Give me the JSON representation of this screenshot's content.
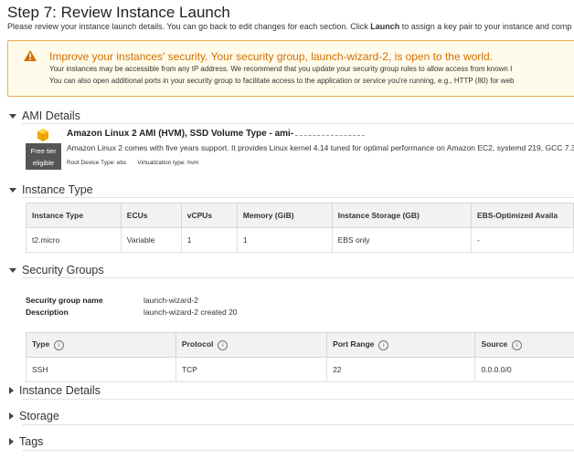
{
  "page": {
    "title": "Step 7: Review Instance Launch",
    "subtitle_pre": "Please review your instance launch details. You can go back to edit changes for each section. Click ",
    "subtitle_bold": "Launch",
    "subtitle_post": " to assign a key pair to your instance and comp"
  },
  "warning": {
    "title": "Improve your instances' security. Your security group, launch-wizard-2, is open to the world.",
    "line1": "Your instances may be accessible from any IP address. We recommend that you update your security group rules to allow access from known I",
    "line2": "You can also open additional ports in your security group to facilitate access to the application or service you're running, e.g., HTTP (80) for web",
    "icon": "warning-icon",
    "accent_color": "#d26f00"
  },
  "ami": {
    "heading": "AMI Details",
    "name": "Amazon Linux 2 AMI (HVM), SSD Volume Type - ami-",
    "description": "Amazon Linux 2 comes with five years support. It provides Linux kernel 4.14 tuned for optimal performance on Amazon EC2, systemd 219, GCC 7.3,",
    "free_tier_line1": "Free tier",
    "free_tier_line2": "eligible",
    "root_device": "Root Device Type: ebs",
    "virtualization": "Virtualization type: hvm",
    "icon": "amazon-linux-cube-icon"
  },
  "instance_type": {
    "heading": "Instance Type",
    "columns": [
      "Instance Type",
      "ECUs",
      "vCPUs",
      "Memory (GiB)",
      "Instance Storage (GB)",
      "EBS-Optimized Availa"
    ],
    "row": [
      "t2.micro",
      "Variable",
      "1",
      "1",
      "EBS only",
      "-"
    ]
  },
  "security_groups": {
    "heading": "Security Groups",
    "name_label": "Security group name",
    "name_value": "launch-wizard-2",
    "desc_label": "Description",
    "desc_value": "launch-wizard-2 created 20",
    "columns": [
      "Type",
      "Protocol",
      "Port Range",
      "Source"
    ],
    "row": [
      "SSH",
      "TCP",
      "22",
      "0.0.0.0/0"
    ],
    "info_glyph": "i"
  },
  "collapsed_sections": [
    "Instance Details",
    "Storage",
    "Tags"
  ]
}
